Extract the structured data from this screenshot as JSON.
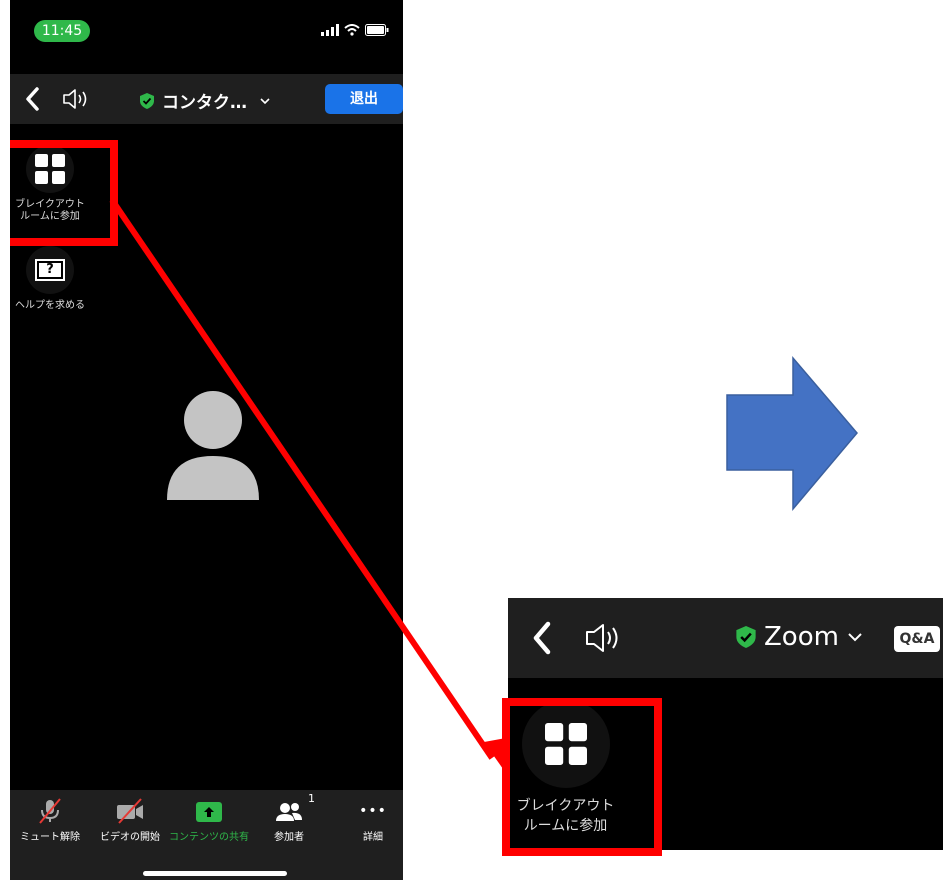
{
  "status": {
    "time": "11:45"
  },
  "topbar": {
    "meeting_title": "コンタク…",
    "leave_label": "退出"
  },
  "side": {
    "breakout_label": "ブレイクアウト\nルームに参加",
    "help_label": "ヘルプを求める",
    "help_glyph": "?"
  },
  "toolbar": {
    "mute_label": "ミュート解除",
    "video_label": "ビデオの開始",
    "share_label": "コンテンツの共有",
    "participants_label": "参加者",
    "participants_count": "1",
    "more_label": "詳細",
    "more_glyph": "•••"
  },
  "zoom": {
    "title": "Zoom",
    "qa_label": "Q&A",
    "breakout_label": "ブレイクアウト\nルームに参加"
  },
  "colors": {
    "accent_blue": "#1a73e8",
    "green": "#2fb84a",
    "red": "#ff0000",
    "arrow_blue": "#4472c4"
  }
}
